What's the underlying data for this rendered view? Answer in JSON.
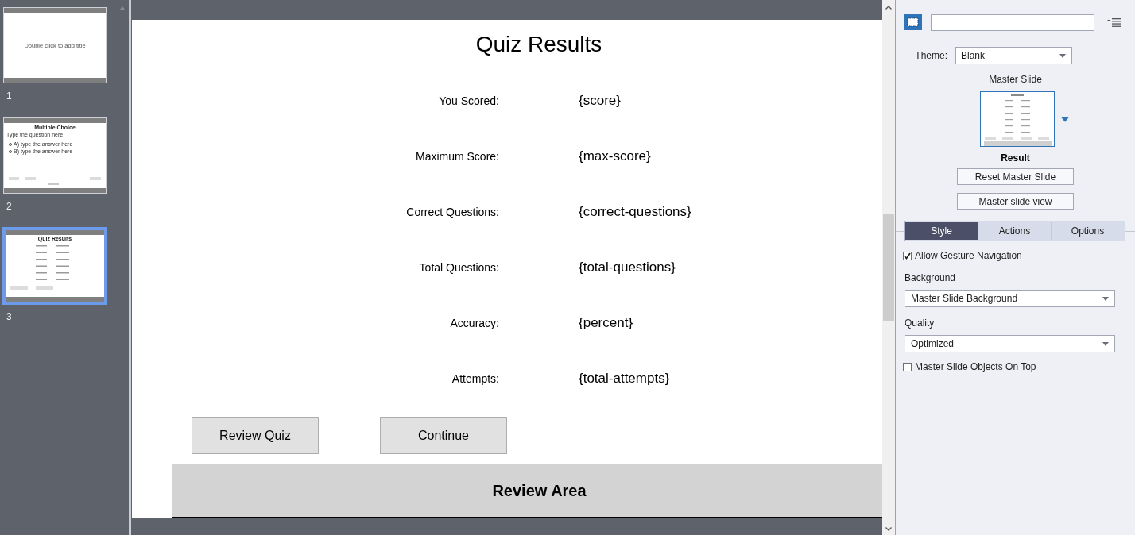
{
  "filmstrip": {
    "slides": [
      {
        "number": "1",
        "selected": false,
        "kind": "title",
        "title": "Double click to add title"
      },
      {
        "number": "2",
        "selected": false,
        "kind": "question",
        "title": "Multiple Choice",
        "question": "Type the question here",
        "answers": [
          "A) type the answer here",
          "B) type the answer here"
        ]
      },
      {
        "number": "3",
        "selected": true,
        "kind": "results",
        "title": "Quiz Results"
      }
    ]
  },
  "slide": {
    "title": "Quiz Results",
    "rows": [
      {
        "label": "You Scored:",
        "value": "{score}"
      },
      {
        "label": "Maximum Score:",
        "value": "{max-score}"
      },
      {
        "label": "Correct Questions:",
        "value": "{correct-questions}"
      },
      {
        "label": "Total Questions:",
        "value": "{total-questions}"
      },
      {
        "label": "Accuracy:",
        "value": "{percent}"
      },
      {
        "label": "Attempts:",
        "value": "{total-attempts}"
      }
    ],
    "buttons": [
      "Review Quiz",
      "Continue"
    ],
    "review_area": "Review Area"
  },
  "properties": {
    "theme": {
      "label": "Theme:",
      "value": "Blank"
    },
    "master_slide": {
      "heading": "Master Slide",
      "name": "Result"
    },
    "buttons": [
      "Reset Master Slide",
      "Master slide view"
    ],
    "tabs": [
      {
        "label": "Style",
        "selected": true
      },
      {
        "label": "Actions",
        "selected": false
      },
      {
        "label": "Options",
        "selected": false
      }
    ],
    "options": [
      {
        "kind": "checkbox",
        "label": "Allow Gesture Navigation",
        "checked": true
      },
      {
        "kind": "select",
        "label": "Background",
        "value": "Master Slide Background"
      },
      {
        "kind": "select",
        "label": "Quality",
        "value": "Optimized"
      },
      {
        "kind": "checkbox",
        "label": "Master Slide Objects On Top",
        "checked": false
      }
    ]
  }
}
